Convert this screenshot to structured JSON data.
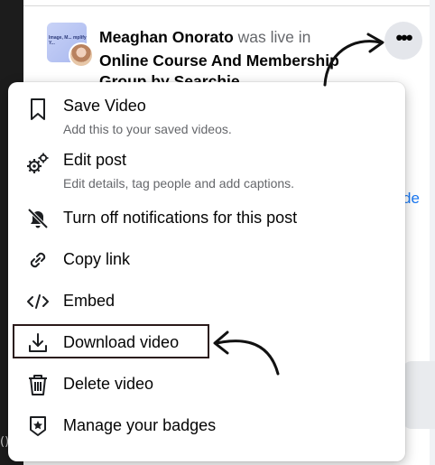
{
  "post": {
    "author": "Meaghan Onorato",
    "action": "was live in",
    "group_line1": "Online Course And Membership",
    "group_line2": "Group by Searchie",
    "thumb_text": "Image, M... mplify Y..."
  },
  "side_link_text": "de",
  "left_glyph": "()",
  "menu": {
    "items": [
      {
        "label": "Save Video",
        "desc": "Add this to your saved videos.",
        "icon": "bookmark-icon"
      },
      {
        "label": "Edit post",
        "desc": "Edit details, tag people and add captions.",
        "icon": "gears-icon"
      },
      {
        "label": "Turn off notifications for this post",
        "icon": "bell-off-icon"
      },
      {
        "label": "Copy link",
        "icon": "link-icon"
      },
      {
        "label": "Embed",
        "icon": "code-icon"
      },
      {
        "label": "Download video",
        "icon": "download-icon"
      },
      {
        "label": "Delete video",
        "icon": "trash-icon"
      },
      {
        "label": "Manage your badges",
        "icon": "badge-icon"
      }
    ]
  },
  "colors": {
    "text": "#050505",
    "secondary_text": "#65676b",
    "link": "#1877f2",
    "highlight_border": "#2a1a1a"
  }
}
